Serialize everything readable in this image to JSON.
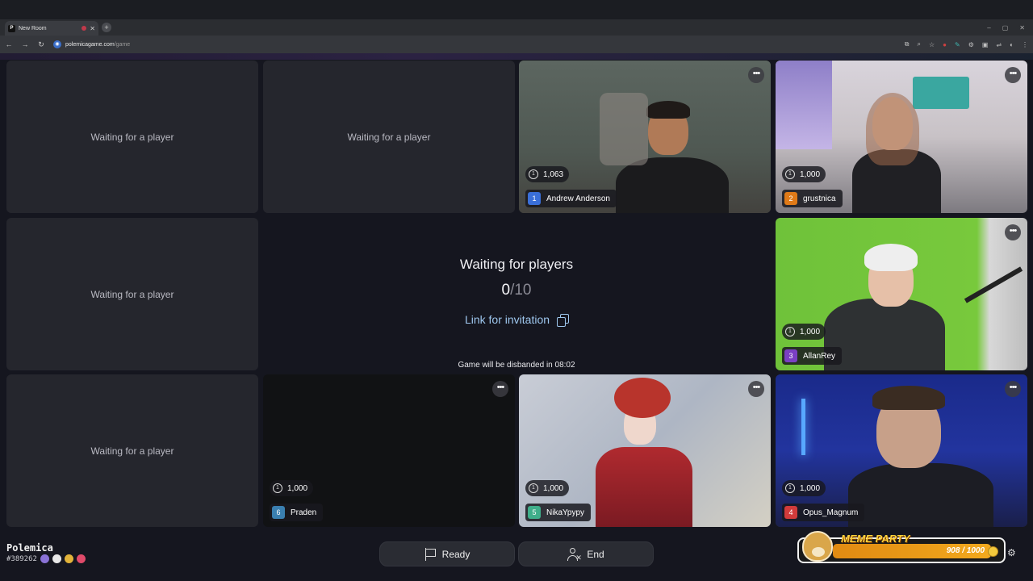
{
  "browser": {
    "tab_title": "New Room",
    "tab_favicon": "P",
    "url_host": "polemicagame.com",
    "url_path": "/game"
  },
  "slots": {
    "waiting_label": "Waiting for a player"
  },
  "players": [
    {
      "num": "1",
      "name": "Andrew Anderson",
      "score": "1,063",
      "color": "#3a6fd8"
    },
    {
      "num": "2",
      "name": "grustnica",
      "score": "1,000",
      "color": "#e07a18"
    },
    {
      "num": "3",
      "name": "AllanRey",
      "score": "1,000",
      "color": "#7a3fc4"
    },
    {
      "num": "4",
      "name": "Opus_Magnum",
      "score": "1,000",
      "color": "#d13b3b"
    },
    {
      "num": "5",
      "name": "NikaYpypy",
      "score": "1,000",
      "color": "#3fae8a"
    },
    {
      "num": "6",
      "name": "Praden",
      "score": "1,000",
      "color": "#3a7fb0"
    }
  ],
  "center": {
    "title": "Waiting for players",
    "count_current": "0",
    "count_total": "/10",
    "invite_label": "Link for invitation",
    "disband_text": "Game will be disbanded in 08:02"
  },
  "footer": {
    "brand": "Polemica",
    "room_id": "#389262",
    "ready_label": "Ready",
    "end_label": "End"
  },
  "overlay": {
    "title": "MEME PARTY",
    "progress": "908 / 1000"
  }
}
